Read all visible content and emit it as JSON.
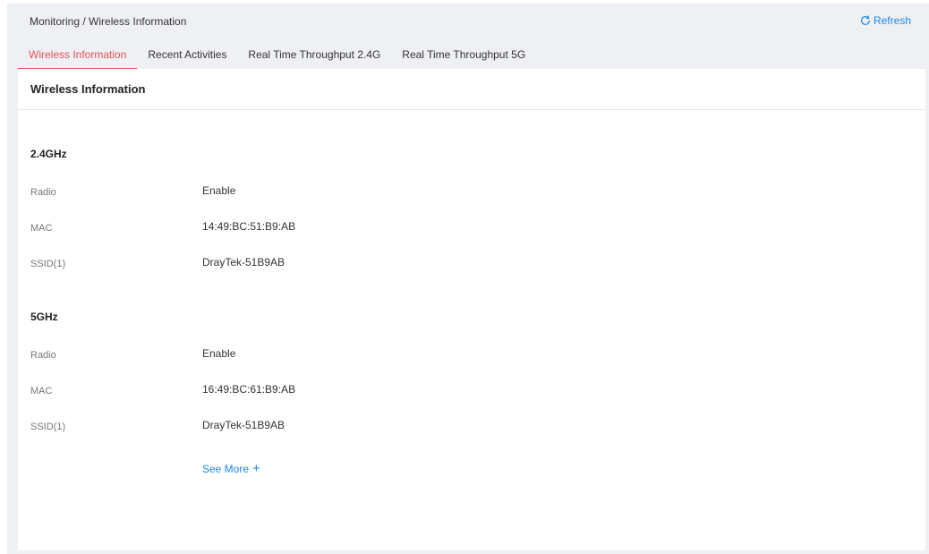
{
  "breadcrumb": "Monitoring / Wireless Information",
  "refresh_label": "Refresh",
  "tabs": [
    {
      "label": "Wireless Information",
      "active": true
    },
    {
      "label": "Recent Activities",
      "active": false
    },
    {
      "label": "Real Time Throughput 2.4G",
      "active": false
    },
    {
      "label": "Real Time Throughput 5G",
      "active": false
    }
  ],
  "panel": {
    "title": "Wireless Information",
    "band24": {
      "title": "2.4GHz",
      "rows": [
        {
          "label": "Radio",
          "value": "Enable"
        },
        {
          "label": "MAC",
          "value": "14:49:BC:51:B9:AB"
        },
        {
          "label": "SSID(1)",
          "value": "DrayTek-51B9AB"
        }
      ]
    },
    "band5": {
      "title": "5GHz",
      "rows": [
        {
          "label": "Radio",
          "value": "Enable"
        },
        {
          "label": "MAC",
          "value": "16:49:BC:61:B9:AB"
        },
        {
          "label": "SSID(1)",
          "value": "DrayTek-51B9AB"
        }
      ]
    },
    "see_more": "See More"
  },
  "colors": {
    "accent": "#e05559",
    "link": "#1e88e5",
    "background": "#eef0f3"
  },
  "icons": {
    "refresh": "refresh-icon",
    "plus": "plus-icon"
  }
}
